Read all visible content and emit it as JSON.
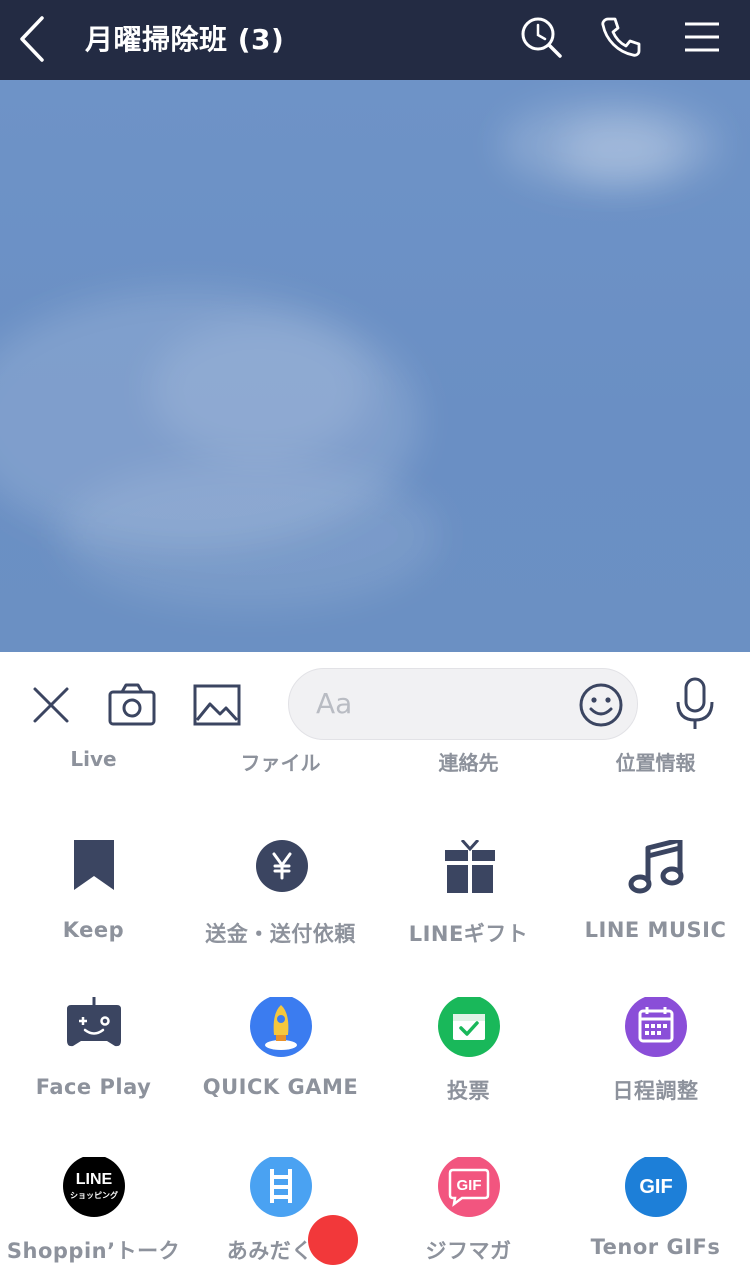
{
  "header": {
    "title": "月曜掃除班 (3)",
    "back_icon": "chevron-left-icon",
    "icons": [
      "search-icon",
      "phone-icon",
      "menu-icon"
    ],
    "background_color": "#232b43"
  },
  "input_bar": {
    "icons": [
      "close-icon",
      "camera-icon",
      "image-icon",
      "microphone-icon"
    ],
    "placeholder": "Aa",
    "emoji_icon": "smiley-icon"
  },
  "cut_off_row": [
    "Live",
    "ファイル",
    "連絡先",
    "位置情報"
  ],
  "menu": {
    "row1": [
      {
        "label": "Keep",
        "icon": "bookmark-icon"
      },
      {
        "label": "送金・送付依頼",
        "icon": "yen-icon"
      },
      {
        "label": "LINEギフト",
        "icon": "gift-icon"
      },
      {
        "label": "LINE MUSIC",
        "icon": "music-note-icon"
      }
    ],
    "row2": [
      {
        "label": "Face Play",
        "icon": "game-face-icon"
      },
      {
        "label": "QUICK GAME",
        "icon": "rocket-icon"
      },
      {
        "label": "投票",
        "icon": "vote-box-icon"
      },
      {
        "label": "日程調整",
        "icon": "calendar-icon"
      }
    ],
    "row3": [
      {
        "label": "Shoppin’トーク",
        "icon": "line-shopping-icon",
        "logo_text": [
          "LINE",
          "ショッピング"
        ]
      },
      {
        "label": "あみだくじ",
        "icon": "ladder-icon"
      },
      {
        "label": "ジフマガ",
        "icon": "gif-magazine-icon",
        "logo_text": "GIF"
      },
      {
        "label": "Tenor GIFs",
        "icon": "tenor-gif-icon",
        "logo_text": "GIF"
      }
    ]
  },
  "colors": {
    "chat_background": "#6c91c5",
    "icon_dark": "#3b4561",
    "label_gray": "#8d929c",
    "quick_game_blue": "#3b7cf0",
    "vote_green": "#19b85a",
    "calendar_purple": "#8a4ed8",
    "ladder_blue": "#4aa2f2",
    "jifmaga_pink": "#f2557f",
    "tenor_blue": "#1d7fd8",
    "indicator_red": "#f2383a"
  }
}
